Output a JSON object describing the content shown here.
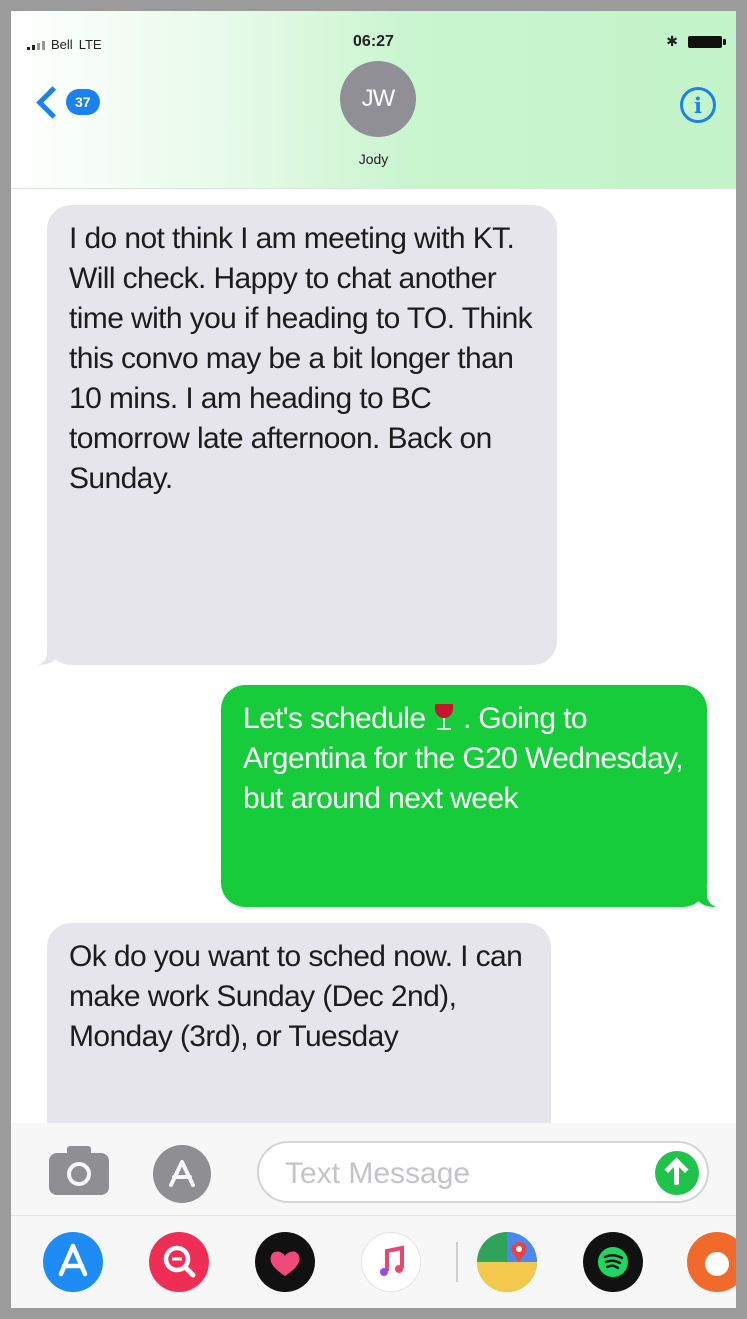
{
  "status_bar": {
    "carrier": "Bell",
    "network": "LTE",
    "time": "06:27",
    "bluetooth_icon": "bluetooth-icon",
    "battery_icon": "battery-icon"
  },
  "header": {
    "back_badge": "37",
    "avatar_initials": "JW",
    "contact_name": "Jody",
    "info_glyph": "i",
    "accent_color": "#1a82f0"
  },
  "messages": [
    {
      "direction": "incoming",
      "text": "I do not think I am meeting with KT. Will check. Happy to chat another time with you if heading to TO. Think this convo may be a bit longer than 10 mins. I am heading to BC tomorrow late afternoon. Back on Sunday."
    },
    {
      "direction": "outgoing",
      "text_before_emoji": "Let's schedule ",
      "emoji": "wine-glass-icon",
      "text_after_emoji": " . Going to Argentina for the G20 Wednesday, but around next week"
    },
    {
      "direction": "incoming",
      "text": "Ok do you want to sched now. I can make work Sunday (Dec 2nd), Monday (3rd), or Tuesday"
    }
  ],
  "compose": {
    "placeholder": "Text Message",
    "value": ""
  },
  "app_strip": [
    "app-store-icon",
    "search-images-icon",
    "heart-stickers-icon",
    "music-icon",
    "maps-icon",
    "spotify-icon",
    "more-app-icon"
  ],
  "colors": {
    "incoming_bubble": "#e6e5eb",
    "outgoing_bubble": "#17cc3b",
    "header_tint": "#c3f4c9"
  }
}
